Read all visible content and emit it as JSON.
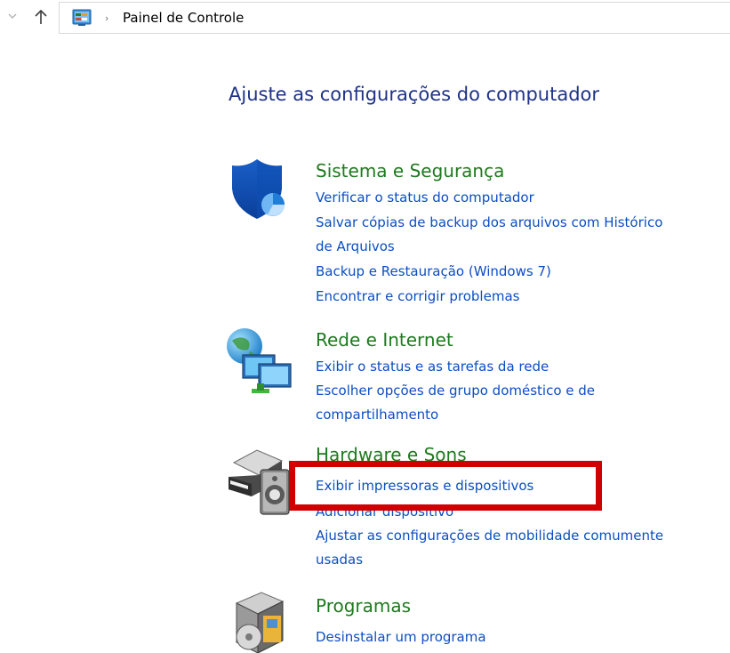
{
  "addressBar": {
    "separator": "›",
    "location": "Painel de Controle"
  },
  "heading": "Ajuste as configurações do computador",
  "categories": [
    {
      "title": "Sistema e Segurança",
      "icon": "shield-icon",
      "links": [
        "Verificar o status do computador",
        "Salvar cópias de backup dos arquivos com Histórico",
        "de Arquivos",
        "Backup e Restauração (Windows 7)",
        "Encontrar e corrigir problemas"
      ]
    },
    {
      "title": "Rede e Internet",
      "icon": "network-icon",
      "links": [
        "Exibir o status e as tarefas da rede",
        "Escolher opções de grupo doméstico e de",
        "compartilhamento"
      ]
    },
    {
      "title": "Hardware e Sons",
      "icon": "printer-speaker-icon",
      "links": [
        "Exibir impressoras e dispositivos",
        "Adicionar dispositivo",
        "Ajustar as configurações de mobilidade comumente",
        "usadas"
      ]
    },
    {
      "title": "Programas",
      "icon": "programs-icon",
      "links": [
        "Desinstalar um programa"
      ]
    }
  ],
  "colors": {
    "heading": "#1e3287",
    "categoryTitle": "#1e7a1e",
    "link": "#0b4ec3",
    "highlight": "#d00000"
  }
}
